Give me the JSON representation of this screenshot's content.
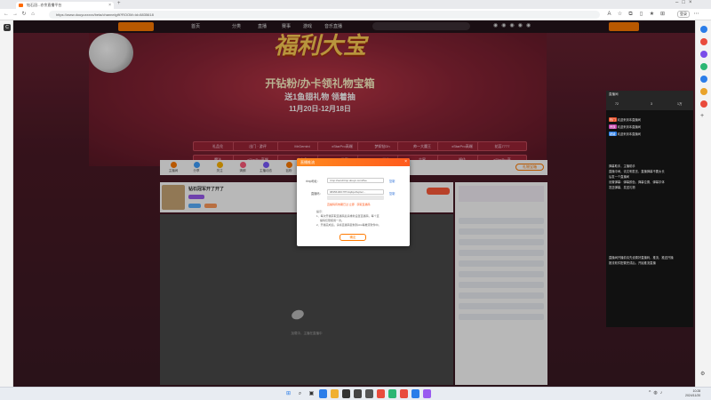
{
  "browser": {
    "tab_title": "钻石冠...亦余直播平台",
    "url": "https://www.douyuxxxxx/beta/channelgift?ROOM=id=8835618",
    "login_label": "登录"
  },
  "site_nav": {
    "items": [
      "首页",
      "分类",
      "直播",
      "赛事",
      "游戏",
      "音乐直播"
    ]
  },
  "hero": {
    "title": "福利大宝",
    "subtitle1": "开钻粉/办卡领礼物宝箱",
    "subtitle2": "送1鱼翅礼物 领着抽",
    "date": "11月20日-12月18日",
    "chips": [
      "礼品兑",
      "出门 · 游评",
      "MrGemini",
      "xStarPro高端",
      "梦如钻Dh",
      "帅一大魔王",
      "xStarPro高端",
      "花蕊7777",
      "魔法",
      "xStarPro高端",
      "小白兔",
      "HK游宪",
      "DYG游佳",
      "吉星",
      "福佳",
      "xStarPro高"
    ]
  },
  "stream": {
    "toolbar_icons": [
      "主播间",
      "分享",
      "关注",
      "清朗",
      "主播动态",
      "钻粉",
      "排行",
      "弹幕",
      "贡献",
      "更多",
      "礼物"
    ],
    "gift_button": "礼物宝箱",
    "streamer_name": "钻石冠军开了开了",
    "video_hint": "加载中，主播在直播中"
  },
  "dialog": {
    "title": "直播推流",
    "label_rtmp": "rtmp地址：",
    "value_rtmp": "rtmp://sendrtmp.douyu.com/live",
    "copy1": "复制",
    "label_key": "直播码：",
    "value_key": "9835618rb7fTh4qZqwSq3ez...",
    "copy2": "复制",
    "note_warn": "直播码有效期已过 立即 · 获取直播码",
    "note_head": "提示：",
    "note1": "1、每次开播获取直播码后请重新设置直播码，每个直",
    "note1b": "播码仅限使用一次。",
    "note2": "2、开播完成后，请将直播码复制到obs等推流软件中。",
    "ok": "确定"
  },
  "side_panel": {
    "title": "直播间",
    "stats": [
      "72",
      "3",
      "1万"
    ],
    "messages": [
      {
        "tag": "热门",
        "color": "#e8502a",
        "text": "欢迎来到本直播间"
      },
      {
        "tag": "贵族",
        "color": "#c23fa8",
        "text": "欢迎来到本直播间"
      },
      {
        "tag": "超级",
        "color": "#2a7de8",
        "text": "欢迎来到本直播间"
      }
    ],
    "notice": [
      "弹幕助手，主播助手",
      "直播中间，请文明发言，直播弹幕不要太长",
      "后发一个直播间",
      "设置弹幕：弹幕颜色、弹幕位置、弹幕字体",
      "发送弹幕、发送礼物"
    ],
    "footer": [
      "直播间开播前请先设置好直播码，推流、推送开播",
      "推流软件配置完成后，开始推流直播"
    ]
  },
  "taskbar": {
    "time": "10:28",
    "date": "2024/11/20"
  }
}
